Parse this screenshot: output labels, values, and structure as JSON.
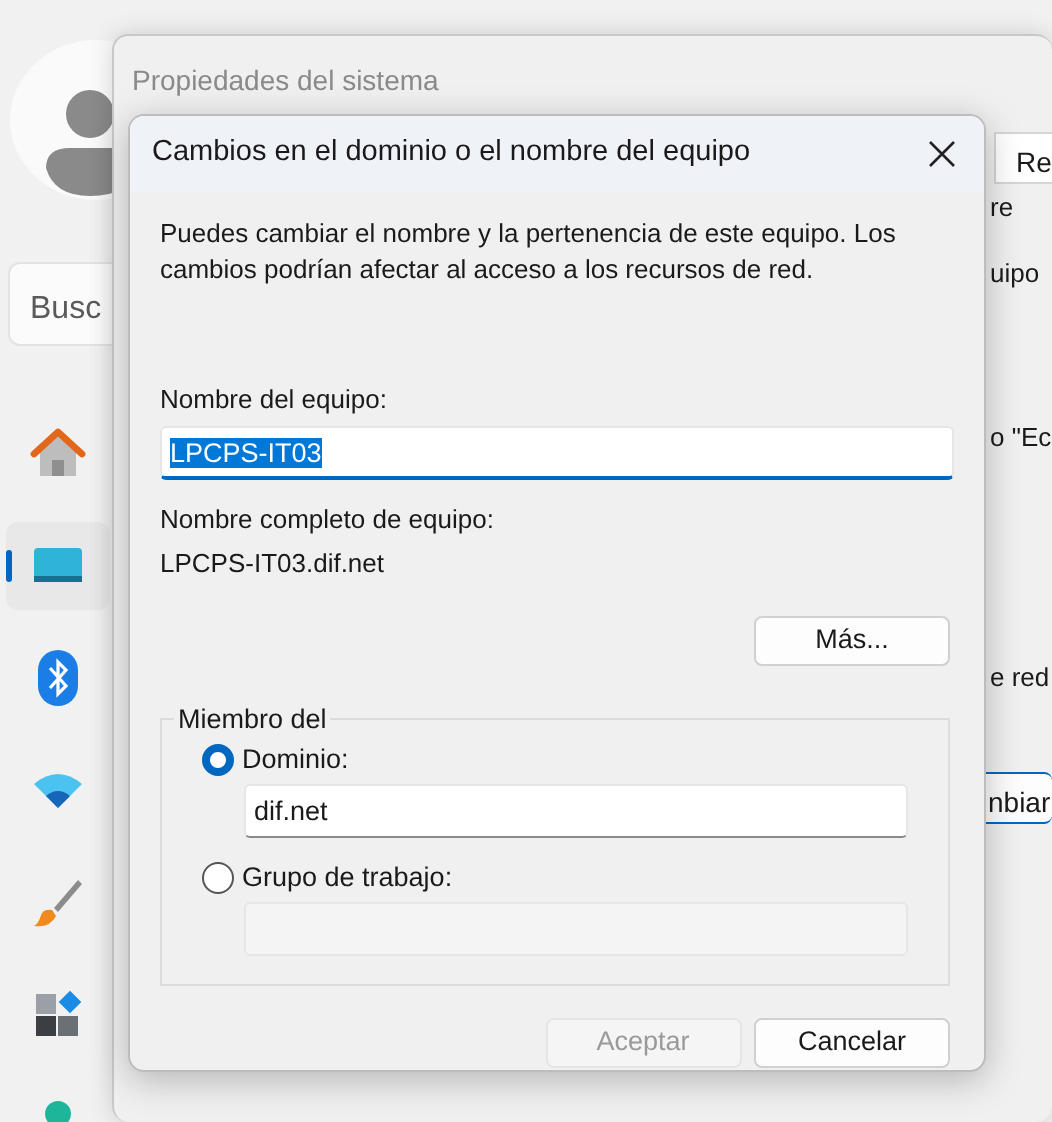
{
  "settings_app": {
    "search": {
      "placeholder": "Busc"
    },
    "nav_items": [
      {
        "kind": "home",
        "selected": false
      },
      {
        "kind": "system",
        "selected": true
      },
      {
        "kind": "bluetooth",
        "selected": false
      },
      {
        "kind": "wifi",
        "selected": false
      },
      {
        "kind": "brush",
        "selected": false
      },
      {
        "kind": "apps",
        "selected": false
      },
      {
        "kind": "account",
        "selected": false
      }
    ]
  },
  "back_window": {
    "title": "Propiedades del sistema",
    "tab": "Re",
    "fragments": [
      "re",
      "uipo",
      "o \"Ec",
      "e red"
    ],
    "button": "nbiar"
  },
  "dialog": {
    "title": "Cambios en el dominio o el nombre del equipo",
    "description": "Puedes cambiar el nombre y la pertenencia de este equipo. Los cambios podrían afectar al acceso a los recursos de red.",
    "computer_name_label": "Nombre del equipo:",
    "computer_name": {
      "value": "LPCPS-IT03",
      "highlighted": true
    },
    "full_name_label": "Nombre completo de equipo:",
    "full_name": "LPCPS-IT03.dif.net",
    "more_button": "Más...",
    "member_of": {
      "legend": "Miembro del",
      "options": [
        {
          "label": "Dominio:",
          "selected": true,
          "value": "dif.net"
        },
        {
          "label": "Grupo de trabajo:",
          "selected": false
        }
      ]
    },
    "buttons": [
      {
        "label": "Aceptar",
        "disabled": true
      },
      {
        "label": "Cancelar",
        "disabled": false
      }
    ]
  }
}
